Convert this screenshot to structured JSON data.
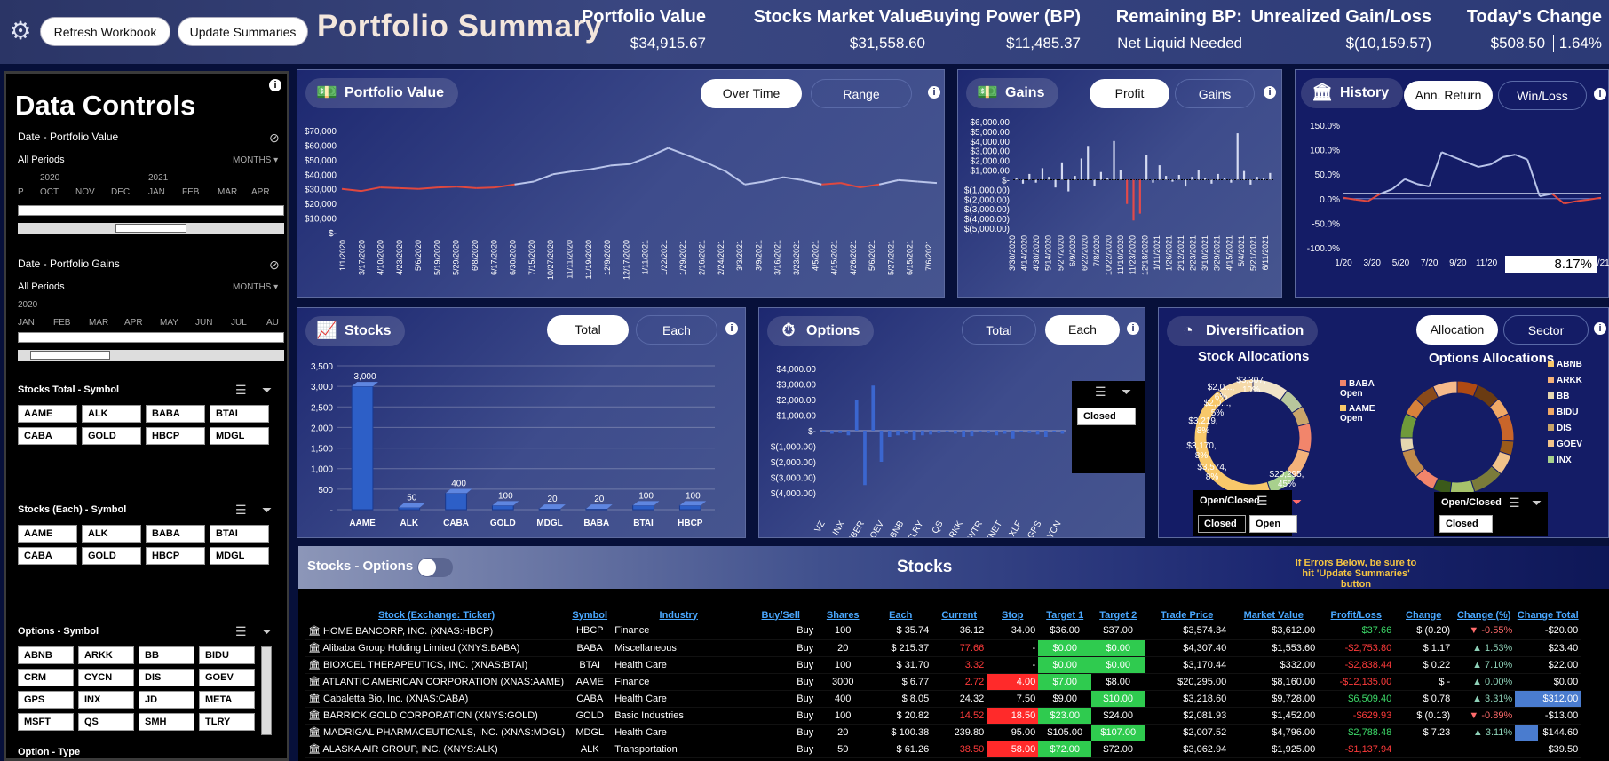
{
  "header": {
    "refresh_label": "Refresh Workbook",
    "update_label": "Update Summaries",
    "title": "Portfolio Summary",
    "metrics": [
      {
        "label": "Portfolio Value",
        "value": "$34,915.67"
      },
      {
        "label": "Stocks Market Value",
        "value": "$31,558.60"
      },
      {
        "label": "Buying Power (BP)",
        "value": "$11,485.37"
      },
      {
        "label": "Remaining BP:",
        "value": "Net Liquid Needed"
      },
      {
        "label": "Unrealized Gain/Loss",
        "value": "$(10,159.57)"
      },
      {
        "label": "Today's Change",
        "value": "$508.50",
        "value2": "1.64%"
      }
    ]
  },
  "sidebar": {
    "title": "Data Controls",
    "date_value": {
      "label": "Date - Portfolio Value",
      "period": "All Periods",
      "unit": "MONTHS",
      "years": [
        "2020",
        "2021"
      ],
      "months": [
        "P",
        "OCT",
        "NOV",
        "DEC",
        "JAN",
        "FEB",
        "MAR",
        "APR"
      ]
    },
    "date_gains": {
      "label": "Date - Portfolio Gains",
      "period": "All Periods",
      "unit": "MONTHS",
      "years": [
        "2020"
      ],
      "months": [
        "JAN",
        "FEB",
        "MAR",
        "APR",
        "MAY",
        "JUN",
        "JUL",
        "AU"
      ]
    },
    "stocks_total": {
      "label": "Stocks Total - Symbol",
      "items": [
        "AAME",
        "ALK",
        "BABA",
        "BTAI",
        "CABA",
        "GOLD",
        "HBCP",
        "MDGL"
      ]
    },
    "stocks_each": {
      "label": "Stocks (Each) - Symbol",
      "items": [
        "AAME",
        "ALK",
        "BABA",
        "BTAI",
        "CABA",
        "GOLD",
        "HBCP",
        "MDGL"
      ]
    },
    "options_symbol": {
      "label": "Options - Symbol",
      "items": [
        "ABNB",
        "ARKK",
        "BB",
        "BIDU",
        "CRM",
        "CYCN",
        "DIS",
        "GOEV",
        "GPS",
        "INX",
        "JD",
        "META",
        "MSFT",
        "QS",
        "SMH",
        "TLRY"
      ]
    },
    "option_type_label": "Option - Type"
  },
  "panels": {
    "portfolio_value": {
      "title": "Portfolio Value",
      "toggle_on": "Over Time",
      "toggle_off": "Range"
    },
    "gains": {
      "title": "Gains",
      "toggle_on": "Profit",
      "toggle_off": "Gains"
    },
    "history": {
      "title": "History",
      "toggle_on": "Ann. Return",
      "toggle_off": "Win/Loss",
      "readout": "8.17%"
    },
    "stocks": {
      "title": "Stocks",
      "toggle_on": "Total",
      "toggle_off": "Each"
    },
    "options": {
      "title": "Options",
      "toggle_off": "Total",
      "toggle_on": "Each",
      "slicer_item": "Closed"
    },
    "diversification": {
      "title": "Diversification",
      "toggle_on": "Allocation",
      "toggle_off": "Sector",
      "stock_alloc_title": "Stock Allocations",
      "options_alloc_title": "Options Allocations",
      "stock_legend": [
        "BABA Open",
        "AAME Open"
      ],
      "options_legend": [
        "ABNB",
        "ARKK",
        "BB",
        "BIDU",
        "DIS",
        "GOEV",
        "INX"
      ],
      "open_closed_label": "Open/Closed",
      "stock_oc_items": [
        "Closed",
        "Open"
      ],
      "opt_oc_items": [
        "Closed"
      ]
    }
  },
  "chart_data": [
    {
      "type": "line",
      "title": "Portfolio Value",
      "y_ticks": [
        "$70,000",
        "$60,000",
        "$50,000",
        "$40,000",
        "$30,000",
        "$20,000",
        "$10,000",
        "$-"
      ],
      "ylim": [
        0,
        70000
      ],
      "x_ticks": [
        "1/1/2020",
        "3/17/2020",
        "4/10/2020",
        "4/23/2020",
        "5/6/2020",
        "5/19/2020",
        "5/29/2020",
        "6/8/2020",
        "6/17/2020",
        "6/30/2020",
        "7/15/2020",
        "10/27/2020",
        "11/11/2020",
        "11/19/2020",
        "12/9/2020",
        "12/17/2020",
        "1/11/2021",
        "1/22/2021",
        "1/29/2021",
        "2/16/2021",
        "2/24/2021",
        "3/3/2021",
        "3/9/2021",
        "3/16/2021",
        "3/23/2021",
        "4/5/2021",
        "4/15/2021",
        "4/26/2021",
        "5/6/2021",
        "5/27/2021",
        "6/15/2021",
        "7/6/2021"
      ],
      "values": [
        30000,
        28500,
        31000,
        30500,
        30000,
        31000,
        31500,
        30500,
        31000,
        33000,
        35000,
        40000,
        42000,
        43500,
        46000,
        47000,
        52000,
        58000,
        53000,
        48000,
        42000,
        33000,
        35000,
        38000,
        36000,
        33000,
        34000,
        31000,
        33000,
        36000,
        35000,
        34000
      ]
    },
    {
      "type": "bar",
      "title": "Gains",
      "y_ticks": [
        "$6,000.00",
        "$5,000.00",
        "$4,000.00",
        "$3,000.00",
        "$2,000.00",
        "$1,000.00",
        "$-",
        "$(1,000.00)",
        "$(2,000.00)",
        "$(3,000.00)",
        "$(4,000.00)",
        "$(5,000.00)"
      ],
      "ylim": [
        -5000,
        6000
      ],
      "x_ticks": [
        "3/30/2020",
        "4/14/2020",
        "4/30/2020",
        "5/14/2020",
        "5/27/2020",
        "6/9/2020",
        "6/22/2020",
        "7/8/2020",
        "10/22/2020",
        "11/10/2020",
        "11/23/2020",
        "12/18/2020",
        "1/11/2021",
        "1/26/2021",
        "2/12/2021",
        "2/23/2021",
        "3/10/2021",
        "3/29/2021",
        "4/15/2021",
        "5/4/2021",
        "5/21/2021",
        "6/11/2021"
      ],
      "values": [
        200,
        -400,
        600,
        -300,
        1200,
        300,
        -800,
        1800,
        -1200,
        400,
        2200,
        3500,
        -600,
        800,
        200,
        4000,
        1000,
        -2500,
        -4200,
        -3500,
        2600,
        -300,
        1500,
        400,
        -200,
        500,
        -700,
        300,
        1000,
        200,
        -400,
        600,
        200,
        -300,
        4800,
        900,
        -500,
        300,
        200,
        700
      ]
    },
    {
      "type": "line",
      "title": "History",
      "y_ticks": [
        "150.0%",
        "100.0%",
        "50.0%",
        "0.0%",
        "-50.0%",
        "-100.0%"
      ],
      "ylim": [
        -100,
        150
      ],
      "x_ticks": [
        "1/20",
        "3/20",
        "5/20",
        "7/20",
        "9/20",
        "11/20",
        "1/21",
        "3/21",
        "5/21",
        "7/21"
      ],
      "values": [
        2,
        -2,
        -5,
        10,
        20,
        40,
        30,
        25,
        95,
        85,
        75,
        65,
        70,
        85,
        90,
        80,
        5,
        10,
        -10,
        -5,
        -2,
        2
      ]
    },
    {
      "type": "bar",
      "title": "Stocks",
      "y_ticks": [
        "3,500",
        "3,000",
        "2,500",
        "2,000",
        "1,500",
        "1,000",
        "500",
        "-"
      ],
      "ylim": [
        0,
        3500
      ],
      "categories": [
        "AAME",
        "ALK",
        "CABA",
        "GOLD",
        "MDGL",
        "BABA",
        "BTAI",
        "HBCP"
      ],
      "values": [
        3000,
        50,
        400,
        100,
        20,
        20,
        100,
        100
      ],
      "data_labels": [
        "3,000",
        "50",
        "400",
        "100",
        "20",
        "20",
        "100",
        "100"
      ]
    },
    {
      "type": "bar",
      "title": "Options",
      "y_ticks": [
        "$4,000.00",
        "$3,000.00",
        "$2,000.00",
        "$1,000.00",
        "$-",
        "$(1,000.00)",
        "$(2,000.00)",
        "$(3,000.00)",
        "$(4,000.00)"
      ],
      "ylim": [
        -4000,
        4000
      ],
      "categories": [
        "VZ",
        "INX",
        "UBER",
        "GOEV",
        "ABNB",
        "TLRY",
        "QS",
        "ARKK",
        "TWTR",
        "XNET",
        "XLF",
        "GPS",
        "CYCN"
      ],
      "values": [
        -100,
        -200,
        -150,
        -300,
        2000,
        -3500,
        2900,
        -2000,
        -400,
        -300,
        -200,
        -600,
        -300,
        -250,
        -150,
        -100,
        -200,
        -400,
        -350,
        -100,
        -150,
        -300,
        -200,
        -500,
        -100,
        -150,
        -250,
        -400,
        -100,
        -200
      ]
    },
    {
      "type": "pie",
      "title": "Stock Allocations",
      "labels": [
        "BABA Open",
        "AAME Open"
      ],
      "slice_labels": [
        "$3,307, 10%",
        "$2,0..., 6%",
        "$2,0..., 5%",
        "$3,219, 8%",
        "$3,170, 8%",
        "$3,574, 8%",
        "$20,295, 45%"
      ],
      "values": [
        10,
        6,
        5,
        8,
        8,
        8,
        45,
        10
      ]
    },
    {
      "type": "pie",
      "title": "Options Allocations",
      "labels": [
        "ABNB",
        "ARKK",
        "BB",
        "BIDU",
        "DIS",
        "GOEV",
        "INX"
      ],
      "values": [
        6,
        7,
        5,
        8,
        4,
        6,
        9,
        7,
        5,
        6,
        8,
        4,
        7,
        5,
        6,
        7
      ]
    }
  ],
  "colors": {
    "accent_line": "#b9c4ea",
    "loss_line": "#e0483f",
    "bar_blue": "#2d5fc7",
    "positive": "#3ddc6a",
    "negative": "#ff3b3b"
  },
  "bottom": {
    "toggle_label": "Stocks - Options",
    "heading": "Stocks",
    "note": "If Errors Below, be sure to hit 'Update Summaries' button",
    "columns": [
      "Stock (Exchange: Ticker)",
      "Symbol",
      "Industry",
      "Buy/Sell",
      "Shares",
      "Each",
      "Current",
      "Stop",
      "Target 1",
      "Target 2",
      "Trade Price",
      "Market Value",
      "Profit/Loss",
      "Change",
      "Change (%)",
      "Change Total"
    ],
    "rows": [
      {
        "name": "HOME BANCORP, INC. (XNAS:HBCP)",
        "symbol": "HBCP",
        "industry": "Finance",
        "bs": "Buy",
        "shares": "100",
        "each": "35.74",
        "current": "36.12",
        "stop": "34.00",
        "t1": "$36.00",
        "t2": "$37.00",
        "trade": "$3,574.34",
        "mkt": "$3,612.00",
        "pl": "$37.66",
        "chg": "(0.20)",
        "chgp": "-0.55%",
        "chgt": "-$20.00"
      },
      {
        "name": "Alibaba Group Holding Limited (XNYS:BABA)",
        "symbol": "BABA",
        "industry": "Miscellaneous",
        "bs": "Buy",
        "shares": "20",
        "each": "215.37",
        "current": "77.66",
        "stop": "-",
        "t1": "$0.00",
        "t2": "$0.00",
        "trade": "$4,307.40",
        "mkt": "$1,553.60",
        "pl": "-$2,753.80",
        "chg": "1.17",
        "chgp": "1.53%",
        "chgt": "$23.40"
      },
      {
        "name": "BIOXCEL THERAPEUTICS, INC. (XNAS:BTAI)",
        "symbol": "BTAI",
        "industry": "Health Care",
        "bs": "Buy",
        "shares": "100",
        "each": "31.70",
        "current": "3.32",
        "stop": "-",
        "t1": "$0.00",
        "t2": "$0.00",
        "trade": "$3,170.44",
        "mkt": "$332.00",
        "pl": "-$2,838.44",
        "chg": "0.22",
        "chgp": "7.10%",
        "chgt": "$22.00"
      },
      {
        "name": "ATLANTIC AMERICAN CORPORATION (XNAS:AAME)",
        "symbol": "AAME",
        "industry": "Finance",
        "bs": "Buy",
        "shares": "3000",
        "each": "6.77",
        "current": "2.72",
        "stop": "4.00",
        "t1": "$7.00",
        "t2": "$8.00",
        "trade": "$20,295.00",
        "mkt": "$8,160.00",
        "pl": "-$12,135.00",
        "chg": "-",
        "chgp": "0.00%",
        "chgt": "$0.00"
      },
      {
        "name": "Cabaletta Bio, Inc. (XNAS:CABA)",
        "symbol": "CABA",
        "industry": "Health Care",
        "bs": "Buy",
        "shares": "400",
        "each": "8.05",
        "current": "24.32",
        "stop": "7.50",
        "t1": "$9.00",
        "t2": "$10.00",
        "trade": "$3,218.60",
        "mkt": "$9,728.00",
        "pl": "$6,509.40",
        "chg": "0.78",
        "chgp": "3.31%",
        "chgt": "$312.00"
      },
      {
        "name": "BARRICK GOLD CORPORATION (XNYS:GOLD)",
        "symbol": "GOLD",
        "industry": "Basic Industries",
        "bs": "Buy",
        "shares": "100",
        "each": "20.82",
        "current": "14.52",
        "stop": "18.50",
        "t1": "$23.00",
        "t2": "$24.00",
        "trade": "$2,081.93",
        "mkt": "$1,452.00",
        "pl": "-$629.93",
        "chg": "(0.13)",
        "chgp": "-0.89%",
        "chgt": "-$13.00"
      },
      {
        "name": "MADRIGAL PHARMACEUTICALS, INC. (XNAS:MDGL)",
        "symbol": "MDGL",
        "industry": "Health Care",
        "bs": "Buy",
        "shares": "20",
        "each": "100.38",
        "current": "239.80",
        "stop": "95.00",
        "t1": "$105.00",
        "t2": "$107.00",
        "trade": "$2,007.52",
        "mkt": "$4,796.00",
        "pl": "$2,788.48",
        "chg": "7.23",
        "chgp": "3.11%",
        "chgt": "$144.60"
      },
      {
        "name": "ALASKA AIR GROUP, INC. (XNYS:ALK)",
        "symbol": "ALK",
        "industry": "Transportation",
        "bs": "Buy",
        "shares": "50",
        "each": "61.26",
        "current": "38.50",
        "stop": "58.00",
        "t1": "$72.00",
        "t2": "$72.00",
        "trade": "$3,062.94",
        "mkt": "$1,925.00",
        "pl": "-$1,137.94",
        "chg": "",
        "chgp": "",
        "chgt": "$39.50"
      }
    ]
  }
}
